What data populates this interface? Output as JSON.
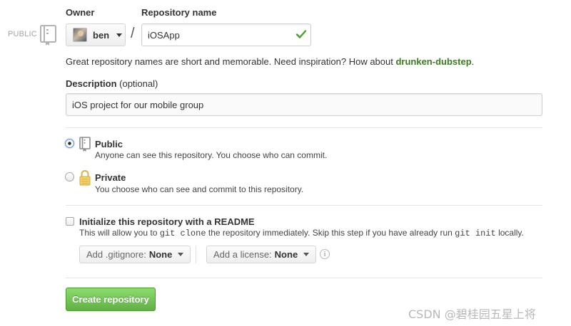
{
  "owner": {
    "label": "Owner",
    "selected": "ben",
    "icon": "avatar"
  },
  "repo_name": {
    "label": "Repository name",
    "value": "iOSApp",
    "valid": true
  },
  "separator": "/",
  "visibility_tag": "PUBLIC",
  "name_hint": {
    "text": "Great repository names are short and memorable. Need inspiration? How about ",
    "suggestion": "drunken-dubstep",
    "end": "."
  },
  "description": {
    "label": "Description",
    "optional": "(optional)",
    "value": "iOS project for our mobile group"
  },
  "visibility": {
    "selected": "public",
    "options": [
      {
        "id": "public",
        "title": "Public",
        "subtitle": "Anyone can see this repository. You choose who can commit.",
        "icon": "repo-book-icon"
      },
      {
        "id": "private",
        "title": "Private",
        "subtitle": "You choose who can see and commit to this repository.",
        "icon": "lock-icon"
      }
    ]
  },
  "readme": {
    "checked": false,
    "title": "Initialize this repository with a README",
    "desc_1": "This will allow you to ",
    "code_1": "git clone",
    "desc_2": " the repository immediately. Skip this step if you have already run ",
    "code_2": "git init",
    "desc_3": " locally."
  },
  "gitignore": {
    "label": "Add .gitignore:",
    "value": "None"
  },
  "license": {
    "label": "Add a license:",
    "value": "None"
  },
  "info_glyph": "i",
  "create_button": "Create repository",
  "watermark": "CSDN @碧桂园五星上将",
  "colors": {
    "suggestion": "#3b7a22",
    "button": "#60b044",
    "check": "#4aa02c"
  }
}
